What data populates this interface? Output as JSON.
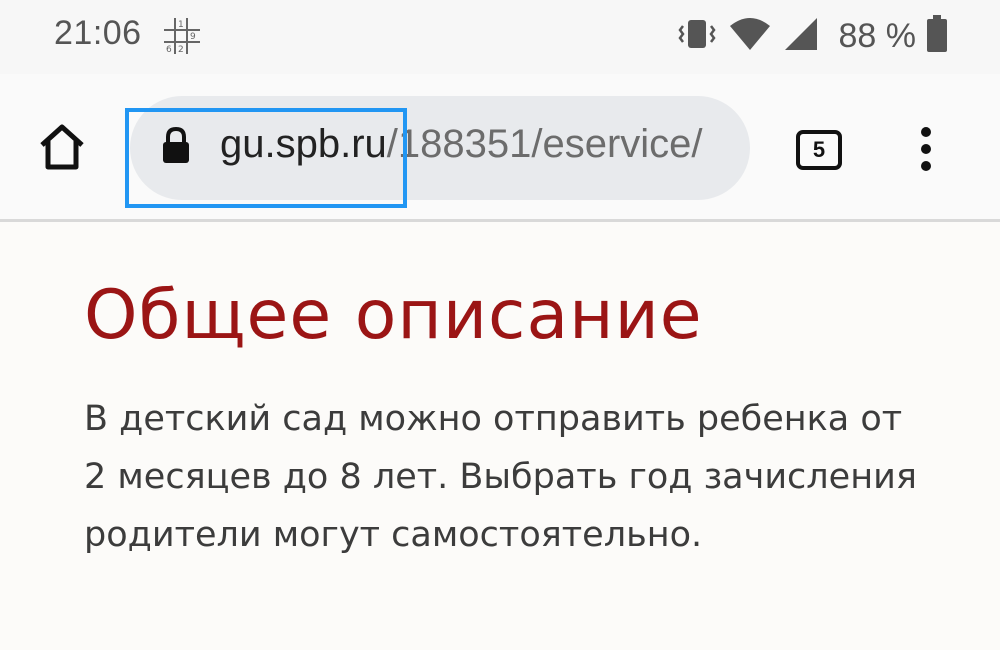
{
  "status_bar": {
    "time": "21:06",
    "battery": "88 %",
    "icons": [
      "notification-grid-icon",
      "vibrate-icon",
      "wifi-icon",
      "signal-icon",
      "battery-icon"
    ]
  },
  "browser": {
    "url_domain": "gu.spb.ru",
    "url_path": "/188351/eservice/",
    "tab_count": "5",
    "icons": [
      "home-icon",
      "lock-icon",
      "overflow-menu-icon"
    ]
  },
  "page": {
    "heading": "Общее описание",
    "description": "В детский сад можно отправить ребенка от 2 месяцев до 8 лет. Выбрать год зачисления родители могут самостоятельно."
  },
  "colors": {
    "heading": "#9b1515",
    "highlight": "#2196f3",
    "urlbar": "#e8eaed"
  }
}
